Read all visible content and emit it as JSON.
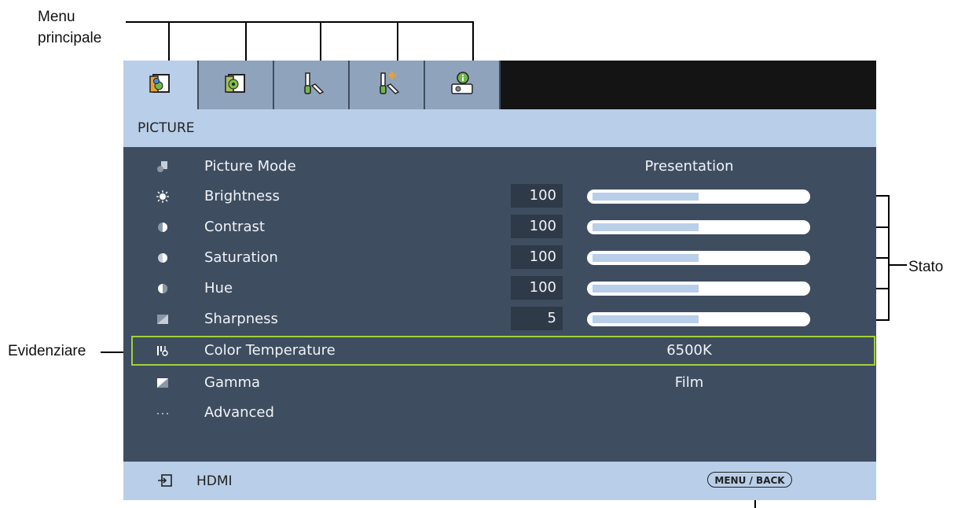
{
  "annotations": {
    "main_menu": "Menu\nprincipale",
    "status": "Stato",
    "highlight": "Evidenziare"
  },
  "tabs": [
    {
      "icon": "picture-icon",
      "active": true
    },
    {
      "icon": "picture-settings-icon",
      "active": false
    },
    {
      "icon": "tools-icon",
      "active": false
    },
    {
      "icon": "advanced-tools-icon",
      "active": false
    },
    {
      "icon": "projector-info-icon",
      "active": false
    }
  ],
  "section": {
    "title": "PICTURE"
  },
  "items": [
    {
      "icon": "picture-mode-icon",
      "label": "Picture Mode",
      "value": "Presentation"
    },
    {
      "icon": "brightness-icon",
      "label": "Brightness",
      "number": "100",
      "level": 0.5
    },
    {
      "icon": "contrast-icon",
      "label": "Contrast",
      "number": "100",
      "level": 0.5
    },
    {
      "icon": "saturation-icon",
      "label": "Saturation",
      "number": "100",
      "level": 0.5
    },
    {
      "icon": "hue-icon",
      "label": "Hue",
      "number": "100",
      "level": 0.5
    },
    {
      "icon": "sharpness-icon",
      "label": "Sharpness",
      "number": "5",
      "level": 0.5
    },
    {
      "icon": "color-temperature-icon",
      "label": "Color Temperature",
      "value": "6500K",
      "highlighted": true
    },
    {
      "icon": "gamma-icon",
      "label": "Gamma",
      "value": "Film"
    },
    {
      "icon": "more-icon",
      "label": "Advanced"
    }
  ],
  "footer": {
    "source_icon": "input-source-icon",
    "source": "HDMI",
    "menu_back": "MENU / BACK"
  },
  "colors": {
    "panel": "#3f4d60",
    "header": "#b9cee8",
    "highlight_border": "#9fd23b"
  }
}
